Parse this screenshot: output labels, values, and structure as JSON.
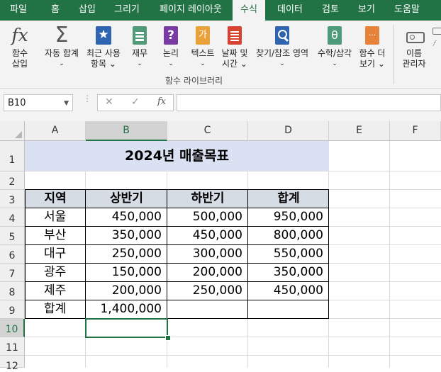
{
  "tabs": [
    "파일",
    "홈",
    "삽입",
    "그리기",
    "페이지 레이아웃",
    "수식",
    "데이터",
    "검토",
    "보기",
    "도움말"
  ],
  "ribbon": {
    "insert_function": [
      "함수",
      "삽입"
    ],
    "autosum": "자동 합계",
    "recent": [
      "최근 사용",
      "항목"
    ],
    "financial": "재무",
    "logical": "논리",
    "text": "텍스트",
    "datetime": [
      "날짜 및",
      "시간"
    ],
    "lookup": "찾기/참조 영역",
    "math": "수학/삼각",
    "more": [
      "함수 더",
      "보기"
    ],
    "group_label": "함수 라이브러리",
    "name_manager": [
      "이름",
      "관리자"
    ],
    "icon_letter_logical": "?",
    "icon_letter_text": "가",
    "icon_letter_math": "θ",
    "icon_letter_more": "···"
  },
  "formula_bar": {
    "name_box": "B10",
    "cancel": "✕",
    "enter": "✓",
    "fx": "fx",
    "formula": ""
  },
  "columns": [
    "A",
    "B",
    "C",
    "D",
    "E",
    "F"
  ],
  "rows": [
    "1",
    "2",
    "3",
    "4",
    "5",
    "6",
    "7",
    "8",
    "9",
    "10",
    "11",
    "12"
  ],
  "sheet": {
    "title": "2024년 매출목표",
    "headers": [
      "지역",
      "상반기",
      "하반기",
      "합계"
    ],
    "data": [
      [
        "서울",
        "450,000",
        "500,000",
        "950,000"
      ],
      [
        "부산",
        "350,000",
        "450,000",
        "800,000"
      ],
      [
        "대구",
        "250,000",
        "300,000",
        "550,000"
      ],
      [
        "광주",
        "150,000",
        "200,000",
        "350,000"
      ],
      [
        "제주",
        "200,000",
        "250,000",
        "450,000"
      ]
    ],
    "total_label": "합계",
    "total_value": "1,400,000"
  },
  "colors": {
    "excel_green": "#217346",
    "title_fill": "#d9e1f2",
    "header_fill": "#d6dce4"
  },
  "selected_cell": "B10"
}
